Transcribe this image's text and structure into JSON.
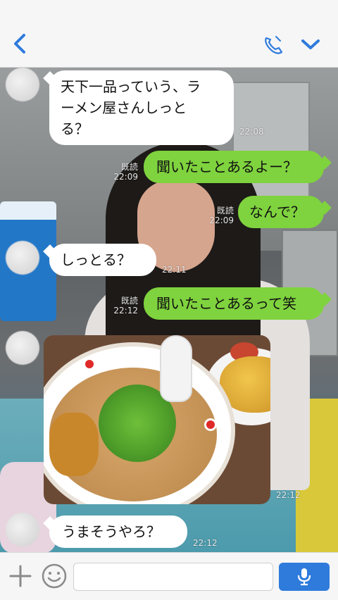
{
  "colors": {
    "accent": "#2f7bdc",
    "bubble_right": "#7fd33e",
    "bubble_left": "#ffffff"
  },
  "header": {
    "back_icon": "chevron-left-icon",
    "call_icon": "phone-icon",
    "menu_icon": "chevron-down-icon"
  },
  "messages": [
    {
      "side": "left",
      "text_line1": "天下一品っていう、ラ",
      "text_line2": "ーメン屋さんしっと",
      "text_line3": "る？",
      "time": "22:08"
    },
    {
      "side": "right",
      "text": "聞いたことあるよー？",
      "read": "既読",
      "time": "22:09"
    },
    {
      "side": "right",
      "text": "なんで？",
      "read": "既読",
      "time": "22:09"
    },
    {
      "side": "left",
      "text": "しっとる？",
      "time": "22:11"
    },
    {
      "side": "right",
      "text": "聞いたことあるって笑",
      "read": "既読",
      "time": "22:12"
    },
    {
      "side": "left",
      "type": "photo",
      "time": "22:12"
    },
    {
      "side": "left",
      "text": "うまそうやろ？",
      "time": "22:12"
    }
  ],
  "composer": {
    "placeholder": ""
  }
}
